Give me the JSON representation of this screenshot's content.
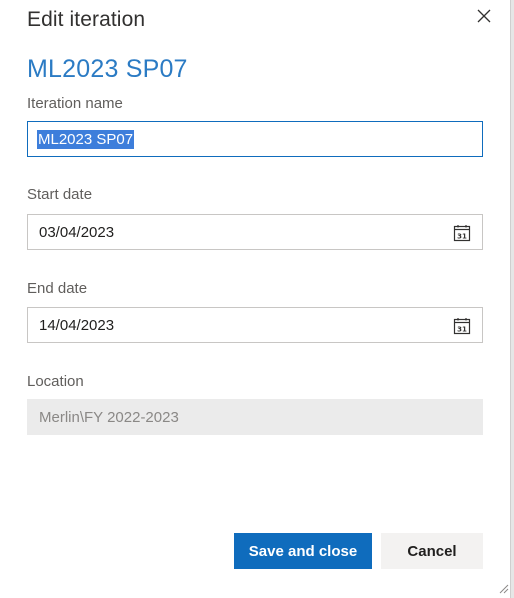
{
  "dialog": {
    "title": "Edit iteration",
    "iteration_heading": "ML2023 SP07"
  },
  "fields": {
    "iteration_name": {
      "label": "Iteration name",
      "value": "ML2023 SP07"
    },
    "start_date": {
      "label": "Start date",
      "value": "03/04/2023",
      "icon_day": "31"
    },
    "end_date": {
      "label": "End date",
      "value": "14/04/2023",
      "icon_day": "31"
    },
    "location": {
      "label": "Location",
      "value": "Merlin\\FY 2022-2023"
    }
  },
  "buttons": {
    "save_label": "Save and close",
    "cancel_label": "Cancel"
  },
  "icons": {
    "close": "close-icon",
    "calendar": "calendar-icon",
    "resize": "resize-grip-icon"
  },
  "colors": {
    "accent": "#0f6cbd",
    "heading": "#2b7bc4",
    "selection": "#3d7edb",
    "disabled_bg": "#ebebeb"
  }
}
